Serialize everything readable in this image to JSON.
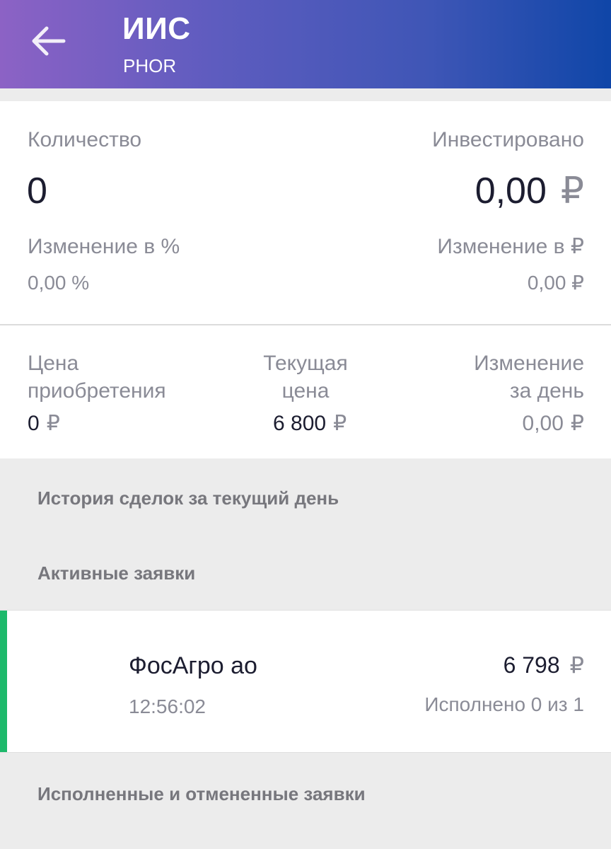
{
  "header": {
    "title": "ИИС",
    "ticker": "PHOR",
    "back_icon": "arrow-left-icon",
    "gradient": [
      "#8c62c5",
      "#0f46a8"
    ]
  },
  "summary": {
    "quantity_label": "Количество",
    "quantity_value": "0",
    "invested_label": "Инвестировано",
    "invested_value": "0,00",
    "currency": "₽",
    "change_pct_label": "Изменение в  %",
    "change_pct_value": "0,00  %",
    "change_rub_label": "Изменение в  ₽",
    "change_rub_value": "0,00  ₽"
  },
  "prices": {
    "purchase_label_1": "Цена",
    "purchase_label_2": "приобретения",
    "purchase_value": "0",
    "current_label_1": "Текущая",
    "current_label_2": "цена",
    "current_value": "6 800",
    "daychange_label_1": "Изменение",
    "daychange_label_2": "за день",
    "daychange_value": "0,00",
    "currency": "₽"
  },
  "sections": {
    "history_title": "История сделок за текущий день",
    "active_title": "Активные заявки",
    "completed_title": "Исполненные и отмененные заявки"
  },
  "active_orders": [
    {
      "name": "ФосАгро ао",
      "time": "12:56:02",
      "price": "6 798",
      "currency": "₽",
      "status": "Исполнено 0 из 1",
      "accent_color": "#1db96b"
    }
  ]
}
